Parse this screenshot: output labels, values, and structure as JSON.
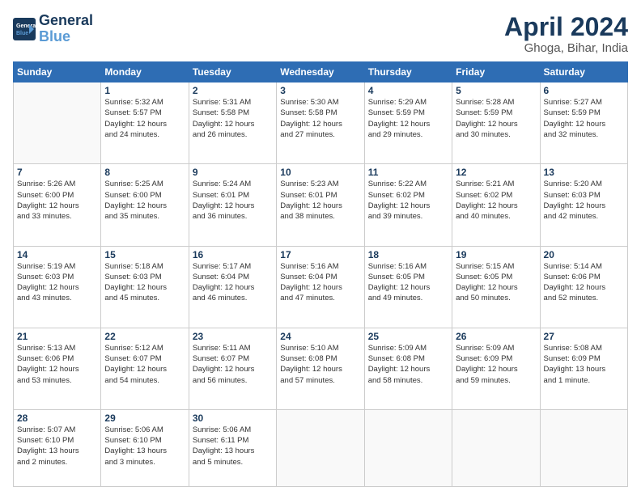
{
  "header": {
    "logo_line1": "General",
    "logo_line2": "Blue",
    "month": "April 2024",
    "location": "Ghoga, Bihar, India"
  },
  "days_of_week": [
    "Sunday",
    "Monday",
    "Tuesday",
    "Wednesday",
    "Thursday",
    "Friday",
    "Saturday"
  ],
  "weeks": [
    [
      {
        "num": "",
        "info": ""
      },
      {
        "num": "1",
        "info": "Sunrise: 5:32 AM\nSunset: 5:57 PM\nDaylight: 12 hours\nand 24 minutes."
      },
      {
        "num": "2",
        "info": "Sunrise: 5:31 AM\nSunset: 5:58 PM\nDaylight: 12 hours\nand 26 minutes."
      },
      {
        "num": "3",
        "info": "Sunrise: 5:30 AM\nSunset: 5:58 PM\nDaylight: 12 hours\nand 27 minutes."
      },
      {
        "num": "4",
        "info": "Sunrise: 5:29 AM\nSunset: 5:59 PM\nDaylight: 12 hours\nand 29 minutes."
      },
      {
        "num": "5",
        "info": "Sunrise: 5:28 AM\nSunset: 5:59 PM\nDaylight: 12 hours\nand 30 minutes."
      },
      {
        "num": "6",
        "info": "Sunrise: 5:27 AM\nSunset: 5:59 PM\nDaylight: 12 hours\nand 32 minutes."
      }
    ],
    [
      {
        "num": "7",
        "info": "Sunrise: 5:26 AM\nSunset: 6:00 PM\nDaylight: 12 hours\nand 33 minutes."
      },
      {
        "num": "8",
        "info": "Sunrise: 5:25 AM\nSunset: 6:00 PM\nDaylight: 12 hours\nand 35 minutes."
      },
      {
        "num": "9",
        "info": "Sunrise: 5:24 AM\nSunset: 6:01 PM\nDaylight: 12 hours\nand 36 minutes."
      },
      {
        "num": "10",
        "info": "Sunrise: 5:23 AM\nSunset: 6:01 PM\nDaylight: 12 hours\nand 38 minutes."
      },
      {
        "num": "11",
        "info": "Sunrise: 5:22 AM\nSunset: 6:02 PM\nDaylight: 12 hours\nand 39 minutes."
      },
      {
        "num": "12",
        "info": "Sunrise: 5:21 AM\nSunset: 6:02 PM\nDaylight: 12 hours\nand 40 minutes."
      },
      {
        "num": "13",
        "info": "Sunrise: 5:20 AM\nSunset: 6:03 PM\nDaylight: 12 hours\nand 42 minutes."
      }
    ],
    [
      {
        "num": "14",
        "info": "Sunrise: 5:19 AM\nSunset: 6:03 PM\nDaylight: 12 hours\nand 43 minutes."
      },
      {
        "num": "15",
        "info": "Sunrise: 5:18 AM\nSunset: 6:03 PM\nDaylight: 12 hours\nand 45 minutes."
      },
      {
        "num": "16",
        "info": "Sunrise: 5:17 AM\nSunset: 6:04 PM\nDaylight: 12 hours\nand 46 minutes."
      },
      {
        "num": "17",
        "info": "Sunrise: 5:16 AM\nSunset: 6:04 PM\nDaylight: 12 hours\nand 47 minutes."
      },
      {
        "num": "18",
        "info": "Sunrise: 5:16 AM\nSunset: 6:05 PM\nDaylight: 12 hours\nand 49 minutes."
      },
      {
        "num": "19",
        "info": "Sunrise: 5:15 AM\nSunset: 6:05 PM\nDaylight: 12 hours\nand 50 minutes."
      },
      {
        "num": "20",
        "info": "Sunrise: 5:14 AM\nSunset: 6:06 PM\nDaylight: 12 hours\nand 52 minutes."
      }
    ],
    [
      {
        "num": "21",
        "info": "Sunrise: 5:13 AM\nSunset: 6:06 PM\nDaylight: 12 hours\nand 53 minutes."
      },
      {
        "num": "22",
        "info": "Sunrise: 5:12 AM\nSunset: 6:07 PM\nDaylight: 12 hours\nand 54 minutes."
      },
      {
        "num": "23",
        "info": "Sunrise: 5:11 AM\nSunset: 6:07 PM\nDaylight: 12 hours\nand 56 minutes."
      },
      {
        "num": "24",
        "info": "Sunrise: 5:10 AM\nSunset: 6:08 PM\nDaylight: 12 hours\nand 57 minutes."
      },
      {
        "num": "25",
        "info": "Sunrise: 5:09 AM\nSunset: 6:08 PM\nDaylight: 12 hours\nand 58 minutes."
      },
      {
        "num": "26",
        "info": "Sunrise: 5:09 AM\nSunset: 6:09 PM\nDaylight: 12 hours\nand 59 minutes."
      },
      {
        "num": "27",
        "info": "Sunrise: 5:08 AM\nSunset: 6:09 PM\nDaylight: 13 hours\nand 1 minute."
      }
    ],
    [
      {
        "num": "28",
        "info": "Sunrise: 5:07 AM\nSunset: 6:10 PM\nDaylight: 13 hours\nand 2 minutes."
      },
      {
        "num": "29",
        "info": "Sunrise: 5:06 AM\nSunset: 6:10 PM\nDaylight: 13 hours\nand 3 minutes."
      },
      {
        "num": "30",
        "info": "Sunrise: 5:06 AM\nSunset: 6:11 PM\nDaylight: 13 hours\nand 5 minutes."
      },
      {
        "num": "",
        "info": ""
      },
      {
        "num": "",
        "info": ""
      },
      {
        "num": "",
        "info": ""
      },
      {
        "num": "",
        "info": ""
      }
    ]
  ]
}
